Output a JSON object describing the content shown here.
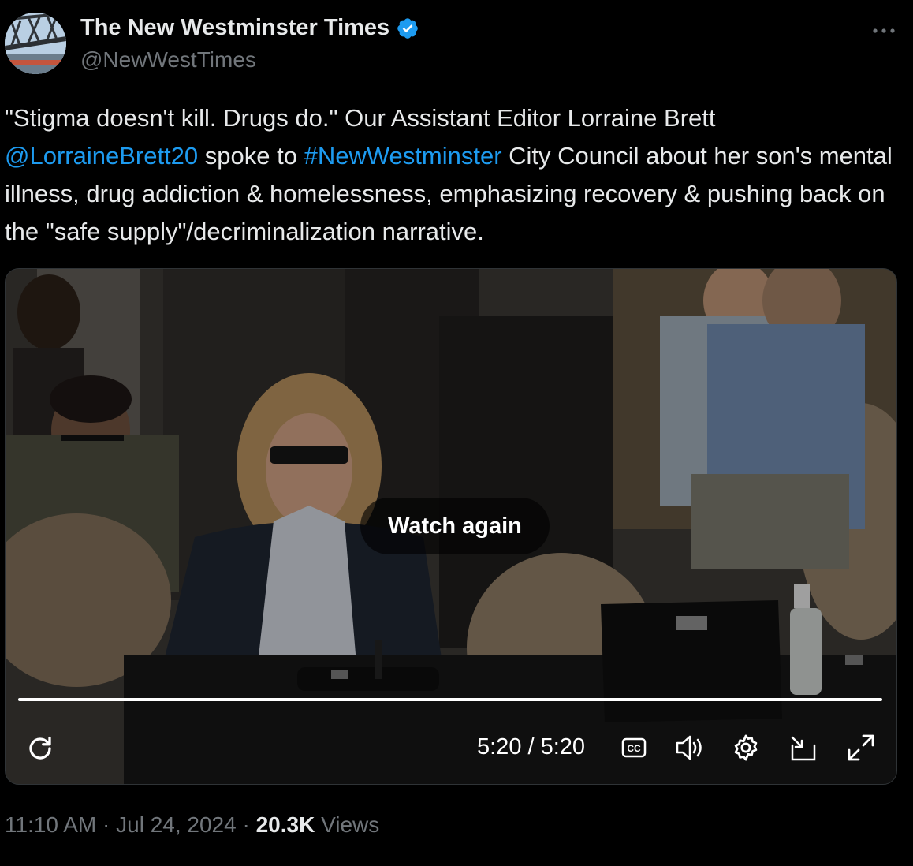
{
  "author": {
    "name": "The New Westminster Times",
    "handle": "@NewWestTimes",
    "verified": true,
    "verified_color": "#1d9bf0"
  },
  "more_icon": "more-horizontal-icon",
  "tweet": {
    "parts": [
      {
        "text": "\"Stigma doesn't kill. Drugs do.\" Our Assistant Editor Lorraine Brett ",
        "type": "text"
      },
      {
        "text": "@LorraineBrett20",
        "type": "mention"
      },
      {
        "text": " spoke to ",
        "type": "text"
      },
      {
        "text": "#NewWestminster",
        "type": "hashtag"
      },
      {
        "text": " City Council about her son's mental illness, drug addiction & homelessness, emphasizing recovery & pushing back on the \"safe supply\"/decriminalization narrative.",
        "type": "text"
      }
    ],
    "link_color": "#1d9bf0"
  },
  "video": {
    "overlay_button": "Watch again",
    "time_display": "5:20 / 5:20",
    "progress": 1.0,
    "controls": [
      "replay-icon",
      "captions-icon",
      "volume-icon",
      "settings-icon",
      "pip-icon",
      "fullscreen-icon"
    ],
    "captions_label": "CC"
  },
  "meta": {
    "time": "11:10 AM",
    "date": "Jul 24, 2024",
    "views_count": "20.3K",
    "views_label": "Views",
    "separator": "·"
  }
}
